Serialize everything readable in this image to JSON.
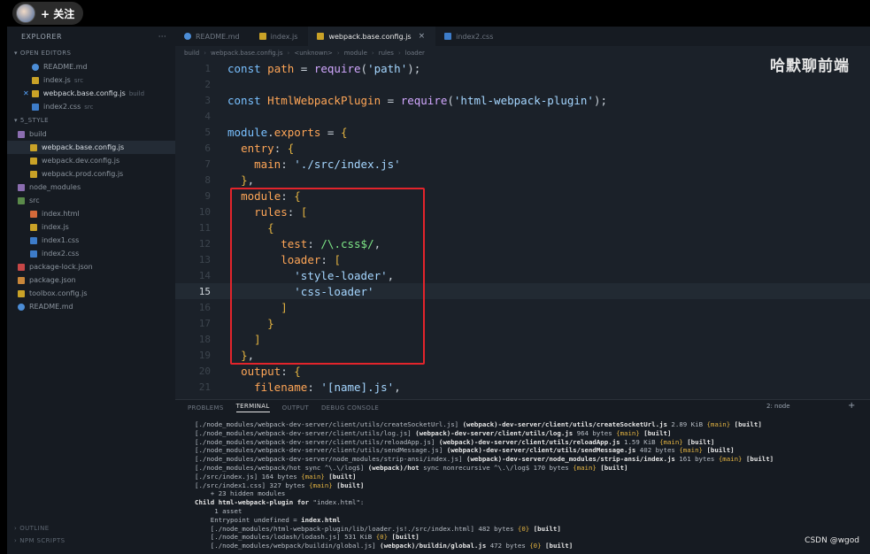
{
  "topbar": {
    "follow_label": "+ 关注"
  },
  "watermark": {
    "channel": "哈默聊前端",
    "csdn": "CSDN @wgod"
  },
  "sidebar": {
    "header": "EXPLORER",
    "header_dots": "···",
    "open_editors_label": "OPEN EDITORS",
    "open_editors": [
      {
        "name": "README.md",
        "icon": "markdown-icon"
      },
      {
        "name": "index.js",
        "note": "src",
        "icon": "js-file-icon"
      },
      {
        "name": "webpack.base.config.js",
        "note": "build",
        "icon": "js-file-icon",
        "modified": true
      },
      {
        "name": "index2.css",
        "note": "src",
        "icon": "css-file-icon"
      }
    ],
    "project_label": "5_STYLE",
    "tree": [
      {
        "name": "build",
        "icon": "folder-icon",
        "depth": 0
      },
      {
        "name": "webpack.base.config.js",
        "icon": "js-file-icon",
        "depth": 1,
        "active": true
      },
      {
        "name": "webpack.dev.config.js",
        "icon": "js-file-icon",
        "depth": 1
      },
      {
        "name": "webpack.prod.config.js",
        "icon": "js-file-icon",
        "depth": 1
      },
      {
        "name": "node_modules",
        "icon": "folder-icon",
        "depth": 0
      },
      {
        "name": "src",
        "icon": "folder-icon",
        "depth": 0
      },
      {
        "name": "index.html",
        "icon": "html-file-icon",
        "depth": 1
      },
      {
        "name": "index.js",
        "icon": "js-file-icon",
        "depth": 1
      },
      {
        "name": "index1.css",
        "icon": "css-file-icon",
        "depth": 1
      },
      {
        "name": "index2.css",
        "icon": "css-file-icon",
        "depth": 1
      },
      {
        "name": "package-lock.json",
        "icon": "lock-file-icon",
        "depth": 0
      },
      {
        "name": "package.json",
        "icon": "json-file-icon",
        "depth": 0
      },
      {
        "name": "toolbox.config.js",
        "icon": "js-file-icon",
        "depth": 0
      },
      {
        "name": "README.md",
        "icon": "markdown-icon",
        "depth": 0
      }
    ],
    "outline_label": "OUTLINE",
    "npm_scripts_label": "NPM SCRIPTS"
  },
  "tabs": [
    {
      "label": "README.md",
      "icon": "markdown-icon"
    },
    {
      "label": "index.js",
      "icon": "js-file-icon"
    },
    {
      "label": "webpack.base.config.js",
      "icon": "js-file-icon",
      "active": true,
      "close": "×"
    },
    {
      "label": "index2.css",
      "icon": "css-file-icon"
    }
  ],
  "breadcrumb": [
    "build",
    "webpack.base.config.js",
    "<unknown>",
    "module",
    "rules",
    "loader"
  ],
  "editor": {
    "current_line": 15,
    "lines": [
      {
        "n": "1",
        "code": "const path = require('path');"
      },
      {
        "n": "2",
        "code": ""
      },
      {
        "n": "3",
        "code": "const HtmlWebpackPlugin = require('html-webpack-plugin');"
      },
      {
        "n": "4",
        "code": ""
      },
      {
        "n": "5",
        "code": "module.exports = {"
      },
      {
        "n": "6",
        "code": "  entry: {"
      },
      {
        "n": "7",
        "code": "    main: './src/index.js'"
      },
      {
        "n": "8",
        "code": "  },"
      },
      {
        "n": "9",
        "code": "  module: {"
      },
      {
        "n": "10",
        "code": "    rules: ["
      },
      {
        "n": "11",
        "code": "      {"
      },
      {
        "n": "12",
        "code": "        test: /\\.css$/,"
      },
      {
        "n": "13",
        "code": "        loader: ["
      },
      {
        "n": "14",
        "code": "          'style-loader',"
      },
      {
        "n": "15",
        "code": "          'css-loader'"
      },
      {
        "n": "16",
        "code": "        ]"
      },
      {
        "n": "17",
        "code": "      }"
      },
      {
        "n": "18",
        "code": "    ]"
      },
      {
        "n": "19",
        "code": "  },"
      },
      {
        "n": "20",
        "code": "  output: {"
      },
      {
        "n": "21",
        "code": "    filename: '[name].js',"
      }
    ]
  },
  "panel": {
    "tabs": [
      "PROBLEMS",
      "TERMINAL",
      "OUTPUT",
      "DEBUG CONSOLE"
    ],
    "active_tab": "TERMINAL",
    "terminal_select": "2: node",
    "add_terminal": "+",
    "lines": [
      "[./node_modules/webpack-dev-server/client/utils/createSocketUrl.js] (webpack)-dev-server/client/utils/createSocketUrl.js 2.89 KiB {main} [built]",
      "[./node_modules/webpack-dev-server/client/utils/log.js] (webpack)-dev-server/client/utils/log.js 964 bytes {main} [built]",
      "[./node_modules/webpack-dev-server/client/utils/reloadApp.js] (webpack)-dev-server/client/utils/reloadApp.js 1.59 KiB {main} [built]",
      "[./node_modules/webpack-dev-server/client/utils/sendMessage.js] (webpack)-dev-server/client/utils/sendMessage.js 402 bytes {main} [built]",
      "[./node_modules/webpack-dev-server/node_modules/strip-ansi/index.js] (webpack)-dev-server/node_modules/strip-ansi/index.js 161 bytes {main} [built]",
      "[./node_modules/webpack/hot sync ^\\.\\/log$] (webpack)/hot sync nonrecursive ^\\.\\/log$ 170 bytes {main} [built]",
      "[./src/index.js] 164 bytes {main} [built]",
      "[./src/index1.css] 327 bytes {main} [built]",
      "    + 23 hidden modules",
      "Child html-webpack-plugin for \"index.html\":",
      "     1 asset",
      "    Entrypoint undefined = index.html",
      "    [./node_modules/html-webpack-plugin/lib/loader.js!./src/index.html] 482 bytes {0} [built]",
      "    [./node_modules/lodash/lodash.js] 531 KiB {0} [built]",
      "    [./node_modules/webpack/buildin/global.js] (webpack)/buildin/global.js 472 bytes {0} [built]"
    ]
  },
  "colors": {
    "highlight_box": "#e3242b",
    "editor_bg": "#1b2129",
    "sidebar_bg": "#161b22"
  }
}
